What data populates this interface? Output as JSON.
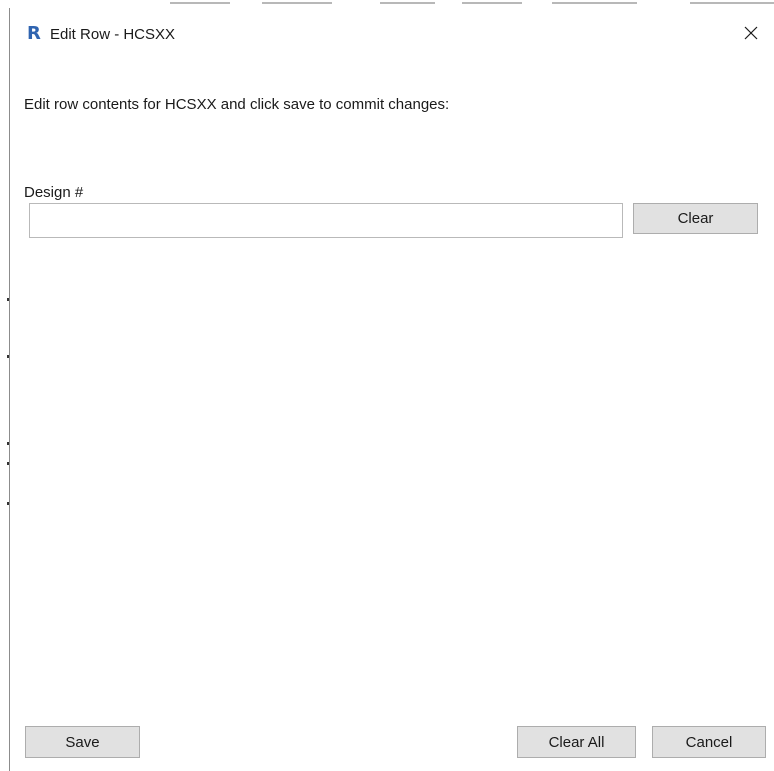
{
  "window": {
    "title": "Edit Row - HCSXX",
    "app_icon": {
      "name": "revit-r-icon",
      "glyph": "R",
      "color": "#2f64b0"
    },
    "close_icon": "close-icon"
  },
  "dialog": {
    "instruction": "Edit row contents for HCSXX and click save to commit changes:",
    "field": {
      "label": "Design #",
      "value": "",
      "clear_label": "Clear"
    }
  },
  "footer": {
    "save_label": "Save",
    "clear_all_label": "Clear All",
    "cancel_label": "Cancel"
  },
  "colors": {
    "button_face": "#e1e1e1",
    "button_border": "#adadad",
    "input_border": "#b9b9b9",
    "text": "#1a1a1a"
  }
}
